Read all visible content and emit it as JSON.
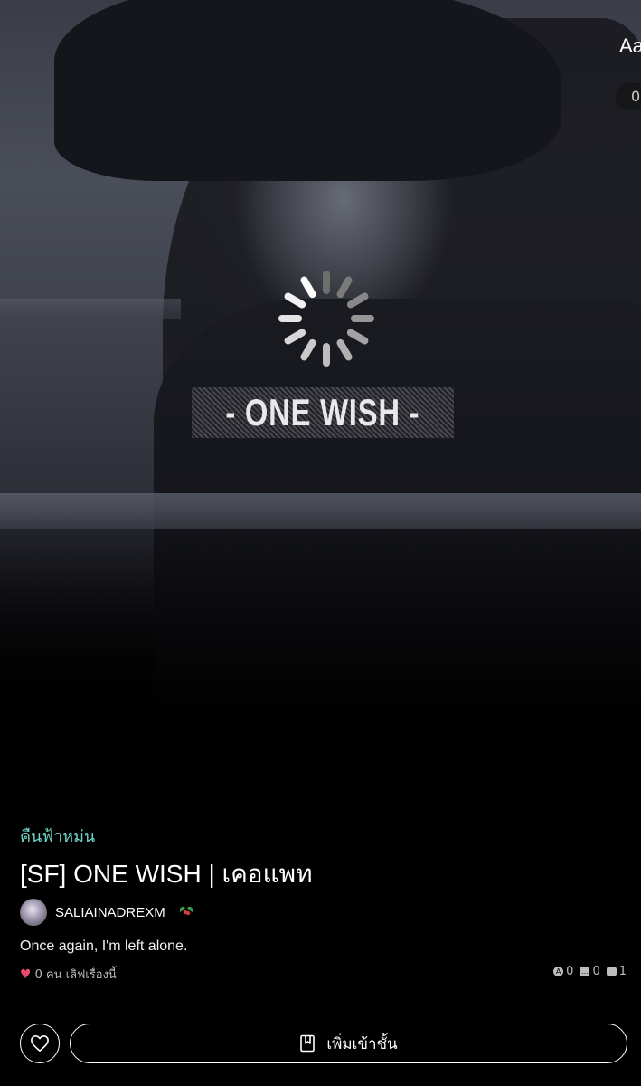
{
  "header": {
    "font_button_label": "Aa",
    "counter_value": "0"
  },
  "cover": {
    "title_text": "- ONE WISH -",
    "loading_spinner": "spinner-icon"
  },
  "story": {
    "category": "คืนฟ้าหม่น",
    "title": "[SF] ONE WISH | เคอแพท",
    "author": "SALIAINADREXM_",
    "author_decoration": "holly-icon",
    "tagline": "Once again, I'm left alone.",
    "likes_text": "0 คน เลิฟเรื่องนี้",
    "stats": {
      "views": "0",
      "comments": "0",
      "chapters": "1"
    }
  },
  "actions": {
    "heart_button": "heart-outline-icon",
    "add_to_shelf_label": "เพิ่มเข้าชั้น"
  },
  "colors": {
    "category": "#6fd4c8",
    "heart": "#e94b6b",
    "background": "#000000"
  }
}
